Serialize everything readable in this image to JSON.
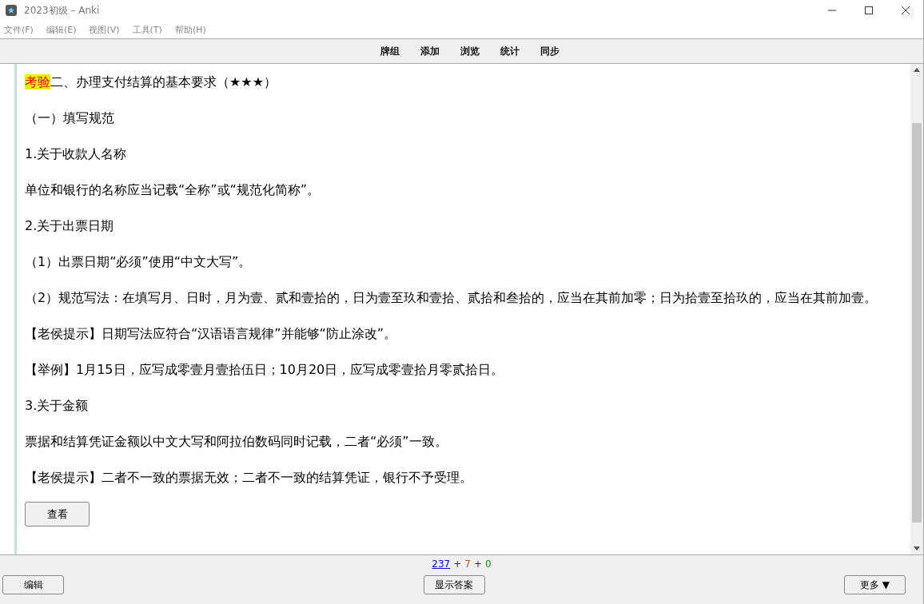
{
  "window": {
    "title": "2023初级 – Anki"
  },
  "menu": [
    "文件(F)",
    "编辑(E)",
    "视图(V)",
    "工具(T)",
    "帮助(H)"
  ],
  "toolbar": [
    "牌组",
    "添加",
    "浏览",
    "统计",
    "同步"
  ],
  "card": {
    "paragraphs": [
      {
        "tag": "考验",
        "text": "二、办理支付结算的基本要求（★★★）"
      },
      {
        "text": "（一）填写规范"
      },
      {
        "text": "1.关于收款人名称"
      },
      {
        "text": "单位和银行的名称应当记载“全称”或“规范化简称”。"
      },
      {
        "text": "2.关于出票日期"
      },
      {
        "text": "（1）出票日期“必须”使用“中文大写”。"
      },
      {
        "text": "（2）规范写法：在填写月、日时，月为壹、贰和壹拾的，日为壹至玖和壹拾、贰拾和叁拾的，应当在其前加零；日为拾壹至拾玖的，应当在其前加壹。"
      },
      {
        "text": "【老侯提示】日期写法应符合“汉语语言规律”并能够“防止涂改”。"
      },
      {
        "text": "【举例】1月15日，应写成零壹月壹拾伍日；10月20日，应写成零壹拾月零贰拾日。"
      },
      {
        "text": "3.关于金额"
      },
      {
        "text": "票据和结算凭证金额以中文大写和阿拉伯数码同时记载，二者“必须”一致。"
      },
      {
        "text": "【老侯提示】二者不一致的票据无效；二者不一致的结算凭证，银行不予受理。"
      }
    ],
    "button": "查看"
  },
  "counts": [
    {
      "text": "237",
      "color": "#0000ff"
    },
    {
      "text": "+"
    },
    {
      "text": "7",
      "color": "#c35617"
    },
    {
      "text": "+"
    },
    {
      "text": "0",
      "color": "#00a000"
    }
  ],
  "bottom": {
    "edit": "编辑",
    "show_answer": "显示答案",
    "more": "更多 ▼"
  }
}
